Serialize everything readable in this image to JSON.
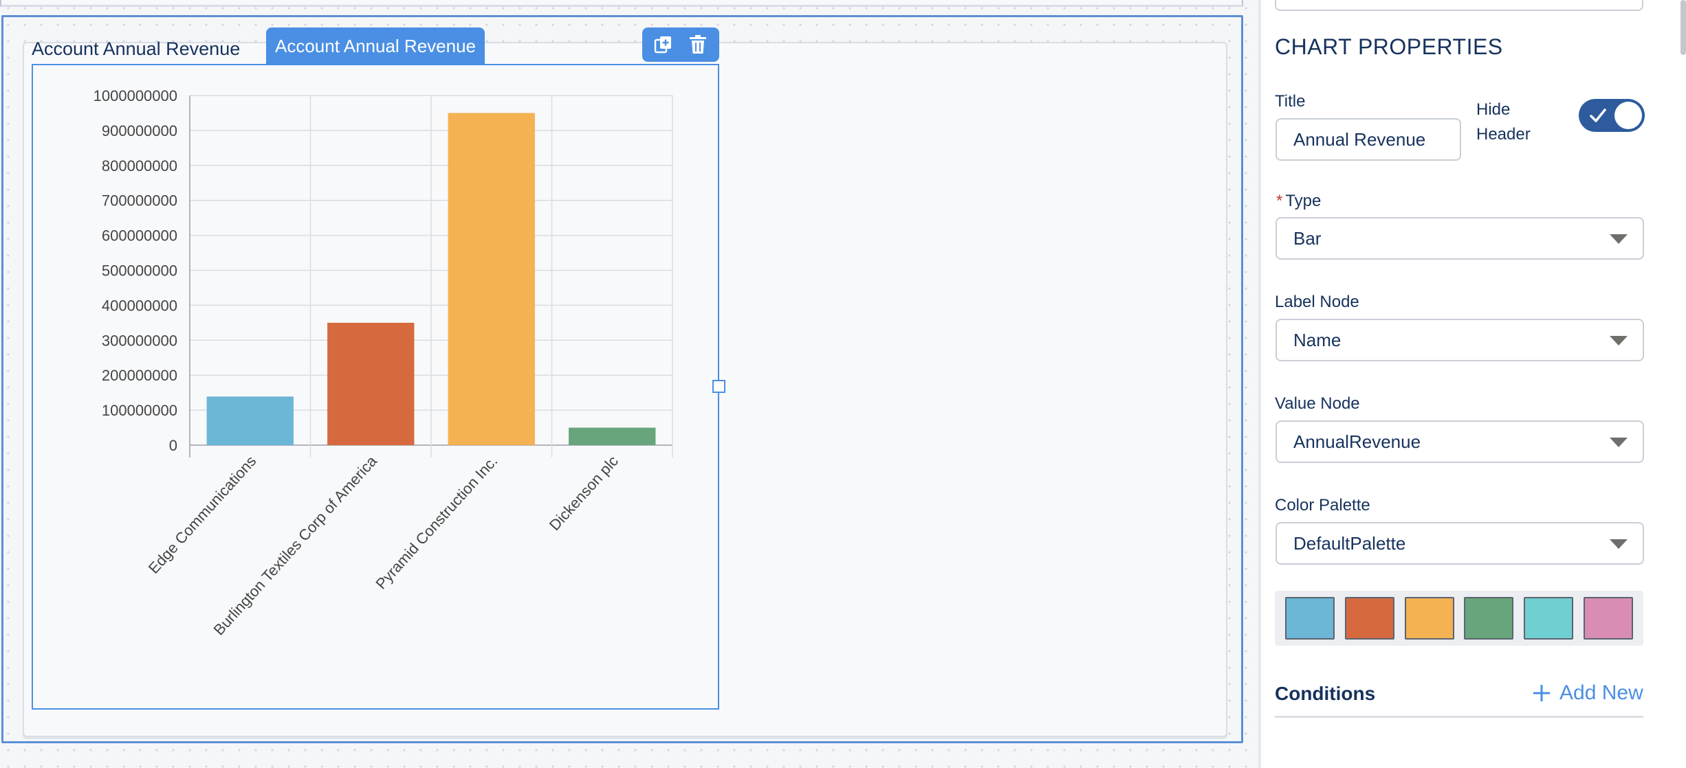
{
  "widget": {
    "title": "Account Annual Revenue",
    "tab_label": "Account Annual Revenue",
    "actions": {
      "duplicate_icon": "duplicate-icon",
      "delete_icon": "trash-icon"
    }
  },
  "chart_data": {
    "type": "bar",
    "categories": [
      "Edge Communications",
      "Burlington Textiles Corp of America",
      "Pyramid Construction Inc.",
      "Dickenson plc"
    ],
    "values": [
      139000000,
      350000000,
      950000000,
      50000000
    ],
    "colors": [
      "#6cb6d6",
      "#d66a3e",
      "#f4b253",
      "#68a57c"
    ],
    "ylim": [
      0,
      1000000000
    ],
    "yticks": [
      "0",
      "100000000",
      "200000000",
      "300000000",
      "400000000",
      "500000000",
      "600000000",
      "700000000",
      "800000000",
      "900000000",
      "1000000000"
    ],
    "grid": true,
    "xlabel": "",
    "ylabel": ""
  },
  "panel": {
    "section_title": "CHART PROPERTIES",
    "title_label": "Title",
    "title_value": "Annual Revenue",
    "hide_header_label_1": "Hide",
    "hide_header_label_2": "Header",
    "hide_header_on": true,
    "type_required": "*",
    "type_label": "Type",
    "type_value": "Bar",
    "label_node_label": "Label Node",
    "label_node_value": "Name",
    "value_node_label": "Value Node",
    "value_node_value": "AnnualRevenue",
    "color_palette_label": "Color Palette",
    "color_palette_value": "DefaultPalette",
    "palette_colors": [
      "#6cb6d6",
      "#d66a3e",
      "#f4b253",
      "#68a57c",
      "#70cfd1",
      "#d98db5"
    ],
    "conditions_label": "Conditions",
    "add_new_label": "Add New"
  }
}
